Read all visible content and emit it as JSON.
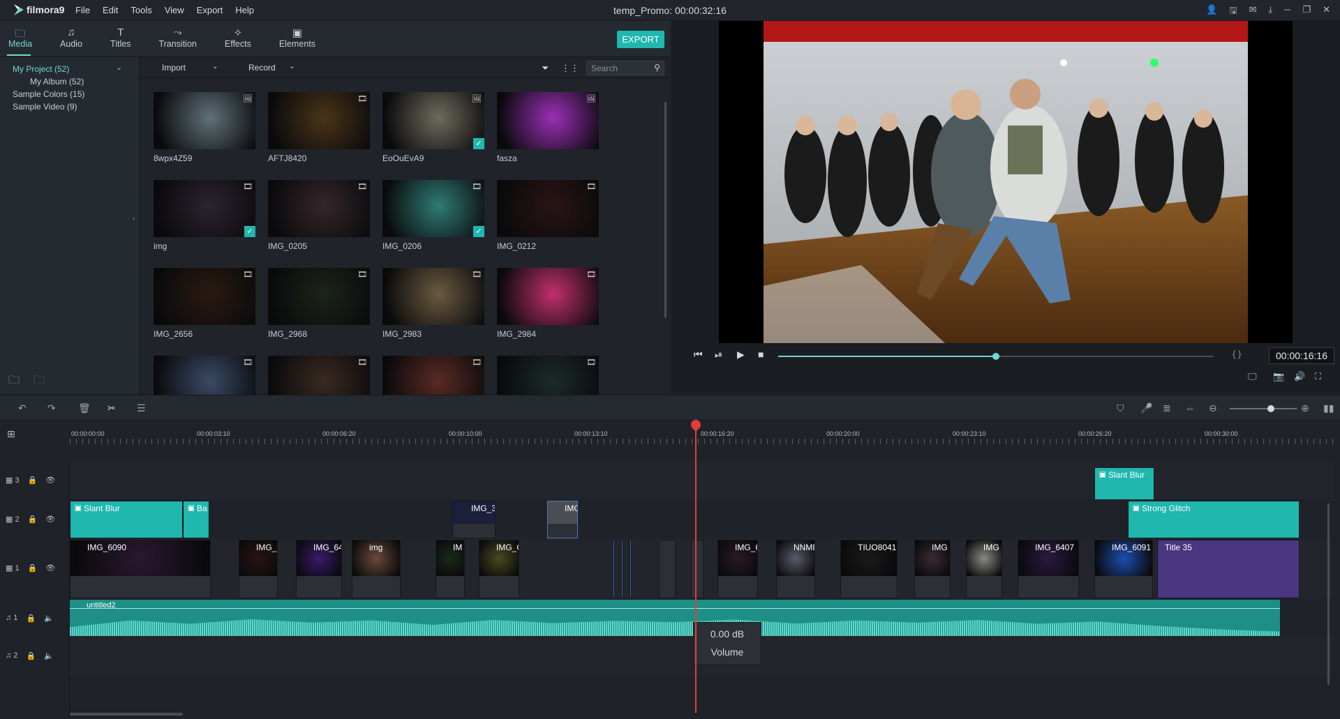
{
  "app": {
    "logo": "filmora9",
    "title": "temp_Promo: 00:00:32:16"
  },
  "menu": [
    "File",
    "Edit",
    "Tools",
    "View",
    "Export",
    "Help"
  ],
  "tabs": [
    {
      "label": "Media",
      "icon": "folder-icon",
      "glyph": "🗀"
    },
    {
      "label": "Audio",
      "icon": "music-note-icon",
      "glyph": "♫"
    },
    {
      "label": "Titles",
      "icon": "text-icon",
      "glyph": "T"
    },
    {
      "label": "Transition",
      "icon": "transition-icon",
      "glyph": "⤳"
    },
    {
      "label": "Effects",
      "icon": "effects-icon",
      "glyph": "✧"
    },
    {
      "label": "Elements",
      "icon": "image-icon",
      "glyph": "▣"
    }
  ],
  "export_label": "EXPORT",
  "library": [
    {
      "label": "My Project (52)",
      "active": true
    },
    {
      "label": "My Album (52)"
    },
    {
      "label": "Sample Colors (15)"
    },
    {
      "label": "Sample Video (9)"
    }
  ],
  "media_toolbar": {
    "import": "Import",
    "record": "Record",
    "search_placeholder": "Search"
  },
  "media": [
    {
      "name": "8wpx4Z59",
      "type": "image",
      "checked": false,
      "tint": "#5f7177"
    },
    {
      "name": "AFTJ8420",
      "type": "video",
      "checked": false,
      "tint": "#4a3418"
    },
    {
      "name": "EoOuEvA9",
      "type": "image",
      "checked": true,
      "tint": "#6e6a5c"
    },
    {
      "name": "fasza",
      "type": "image",
      "checked": false,
      "tint": "#9b2fb5"
    },
    {
      "name": "img",
      "type": "video",
      "checked": true,
      "tint": "#2c2430"
    },
    {
      "name": "IMG_0205",
      "type": "video",
      "checked": false,
      "tint": "#35262a"
    },
    {
      "name": "IMG_0206",
      "type": "video",
      "checked": true,
      "tint": "#2f7b74"
    },
    {
      "name": "IMG_0212",
      "type": "video",
      "checked": false,
      "tint": "#2a1414"
    },
    {
      "name": "IMG_2656",
      "type": "video",
      "checked": false,
      "tint": "#2a1a10"
    },
    {
      "name": "IMG_2968",
      "type": "video",
      "checked": false,
      "tint": "#1c2418"
    },
    {
      "name": "IMG_2983",
      "type": "video",
      "checked": false,
      "tint": "#6a5a40"
    },
    {
      "name": "IMG_2984",
      "type": "video",
      "checked": false,
      "tint": "#c0306a"
    },
    {
      "name": "",
      "type": "video",
      "checked": false,
      "tint": "#3a4a66"
    },
    {
      "name": "",
      "type": "video",
      "checked": false,
      "tint": "#3a2a22"
    },
    {
      "name": "",
      "type": "video",
      "checked": false,
      "tint": "#5a2a22"
    },
    {
      "name": "",
      "type": "video",
      "checked": false,
      "tint": "#1c2a2a"
    }
  ],
  "player": {
    "timecode": "00:00:16:16",
    "progress": 0.5,
    "brackets": "{ }"
  },
  "ruler": [
    "00:00:00:00",
    "00:00:03:10",
    "00:00:06:20",
    "00:00:10:00",
    "00:00:13:10",
    "00:00:16:20",
    "00:00:20:00",
    "00:00:23:10",
    "00:00:26:20",
    "00:00:30:00"
  ],
  "tracks": {
    "v3": {
      "label": "3"
    },
    "v2": {
      "label": "2"
    },
    "v1": {
      "label": "1"
    },
    "a1": {
      "label": "1"
    },
    "a2": {
      "label": "2"
    }
  },
  "clips": {
    "slant_blur_v3": "Slant Blur",
    "slant_blur_v2": "Slant Blur",
    "ba": "Ba",
    "img_3": "IMG_3",
    "img_t": "IMG",
    "strong_glitch": "Strong Glitch",
    "v1": [
      "IMG_6090",
      "IMG_",
      "IMG_64",
      "img",
      "IM",
      "IMG_C",
      "IMG_6",
      "NNME",
      "TIUO8041",
      "IMG",
      "IMG",
      "IMG_6407",
      "IMG_6091",
      "Title 35"
    ]
  },
  "audio": {
    "name": "untitled2",
    "db": "0.00 dB",
    "volume_label": "Volume"
  }
}
